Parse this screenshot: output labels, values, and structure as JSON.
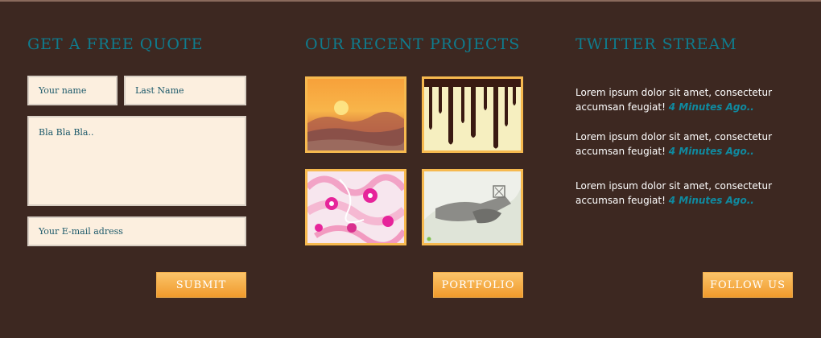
{
  "quote": {
    "heading": "GET A FREE QUOTE",
    "first_name_placeholder": "Your name",
    "last_name_placeholder": "Last Name",
    "message_placeholder": "Bla Bla Bla..",
    "email_placeholder": "Your E-mail adress",
    "submit_label": "SUBMIT"
  },
  "projects": {
    "heading": "OUR RECENT PROJECTS",
    "thumbnails": [
      {
        "name": "sunset-landscape"
      },
      {
        "name": "dripping-paint"
      },
      {
        "name": "pink-abstract-illustration"
      },
      {
        "name": "sketch-figure-illustration"
      }
    ],
    "portfolio_label": "PORTFOLIO"
  },
  "twitter": {
    "heading": "TWITTER STREAM",
    "tweets": [
      {
        "text": "Lorem ipsum dolor sit amet, consectetur accumsan feugiat!",
        "time": "4 Minutes Ago.."
      },
      {
        "text": "Lorem ipsum dolor sit amet, consectetur accumsan feugiat!",
        "time": "4 Minutes Ago.."
      },
      {
        "text": "Lorem ipsum dolor sit amet, consectetur accumsan feugiat!",
        "time": "4 Minutes Ago.."
      }
    ],
    "follow_label": "FOLLOW US"
  },
  "colors": {
    "background": "#3d2821",
    "heading": "#0f7c8e",
    "field_background": "#fcefdf",
    "button": "#f6a83a",
    "thumb_border": "#f6b94f"
  }
}
